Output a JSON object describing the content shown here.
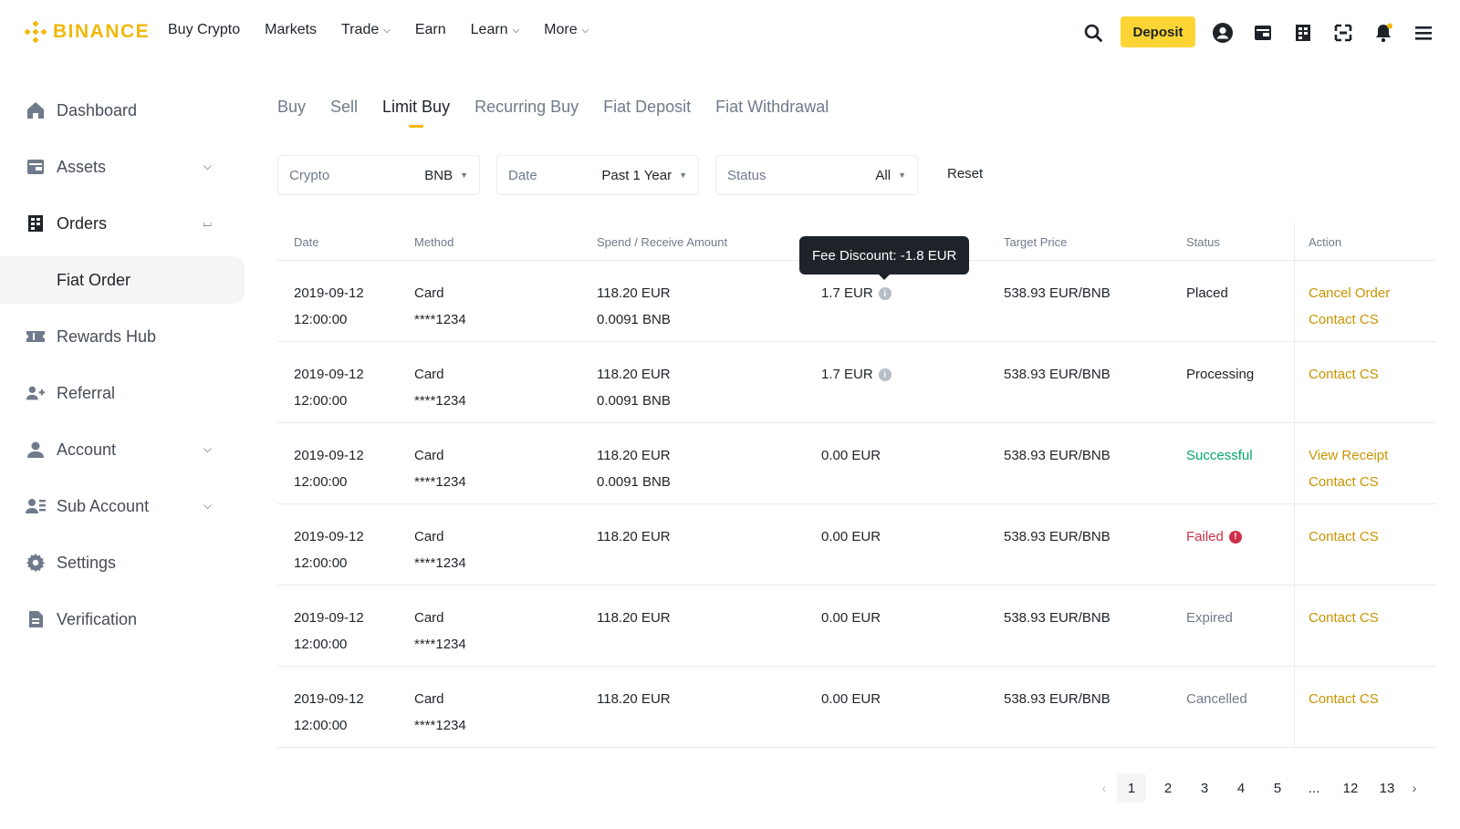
{
  "brand": {
    "name": "BINANCE",
    "color": "#f0b90b"
  },
  "nav": {
    "links": [
      {
        "label": "Buy Crypto",
        "has_dropdown": false
      },
      {
        "label": "Markets",
        "has_dropdown": false
      },
      {
        "label": "Trade",
        "has_dropdown": true
      },
      {
        "label": "Earn",
        "has_dropdown": false
      },
      {
        "label": "Learn",
        "has_dropdown": true
      },
      {
        "label": "More",
        "has_dropdown": true
      }
    ],
    "deposit_label": "Deposit",
    "icons": [
      "search-icon",
      "user-icon",
      "wallet-icon",
      "orders-icon",
      "download-icon",
      "bell-icon",
      "menu-icon"
    ]
  },
  "sidebar": {
    "items": [
      {
        "label": "Dashboard",
        "icon": "home-icon"
      },
      {
        "label": "Assets",
        "icon": "wallet-icon",
        "expanded": false
      },
      {
        "label": "Orders",
        "icon": "orders-icon",
        "expanded": true,
        "subitems": [
          {
            "label": "Fiat Order",
            "selected": true
          }
        ]
      },
      {
        "label": "Rewards Hub",
        "icon": "ticket-icon"
      },
      {
        "label": "Referral",
        "icon": "add-user-icon"
      },
      {
        "label": "Account",
        "icon": "person-icon",
        "expanded": false
      },
      {
        "label": "Sub Account",
        "icon": "sub-account-icon",
        "expanded": false
      },
      {
        "label": "Settings",
        "icon": "gear-icon"
      },
      {
        "label": "Verification",
        "icon": "document-icon"
      }
    ]
  },
  "tabs": [
    {
      "label": "Buy",
      "active": false
    },
    {
      "label": "Sell",
      "active": false
    },
    {
      "label": "Limit Buy",
      "active": true
    },
    {
      "label": "Recurring Buy",
      "active": false
    },
    {
      "label": "Fiat Deposit",
      "active": false
    },
    {
      "label": "Fiat Withdrawal",
      "active": false
    }
  ],
  "filters": {
    "crypto": {
      "label": "Crypto",
      "value": "BNB"
    },
    "date": {
      "label": "Date",
      "value": "Past 1 Year"
    },
    "status": {
      "label": "Status",
      "value": "All"
    },
    "reset_label": "Reset"
  },
  "table": {
    "headers": {
      "date": "Date",
      "method": "Method",
      "amount": "Spend / Receive Amount",
      "target_price": "Target Price",
      "status": "Status",
      "action": "Action"
    },
    "rows": [
      {
        "date": "2019-09-12",
        "time": "12:00:00",
        "method": "Card",
        "card": "****1234",
        "spend": "118.20 EUR",
        "receive": "0.0091 BNB",
        "fee": "1.7 EUR",
        "fee_info": true,
        "price": "538.93 EUR/BNB",
        "status": "Placed",
        "status_type": "normal",
        "actions": [
          "Cancel Order",
          "Contact CS"
        ]
      },
      {
        "date": "2019-09-12",
        "time": "12:00:00",
        "method": "Card",
        "card": "****1234",
        "spend": "118.20 EUR",
        "receive": "0.0091 BNB",
        "fee": "1.7 EUR",
        "fee_info": true,
        "price": "538.93 EUR/BNB",
        "status": "Processing",
        "status_type": "normal",
        "actions": [
          "Contact CS"
        ]
      },
      {
        "date": "2019-09-12",
        "time": "12:00:00",
        "method": "Card",
        "card": "****1234",
        "spend": "118.20 EUR",
        "receive": "0.0091 BNB",
        "fee": "0.00 EUR",
        "fee_info": false,
        "price": "538.93 EUR/BNB",
        "status": "Successful",
        "status_type": "success",
        "actions": [
          "View Receipt",
          "Contact CS"
        ]
      },
      {
        "date": "2019-09-12",
        "time": "12:00:00",
        "method": "Card",
        "card": "****1234",
        "spend": "118.20 EUR",
        "receive": "",
        "fee": "0.00 EUR",
        "fee_info": false,
        "price": "538.93 EUR/BNB",
        "status": "Failed",
        "status_type": "failed",
        "actions": [
          "Contact CS"
        ]
      },
      {
        "date": "2019-09-12",
        "time": "12:00:00",
        "method": "Card",
        "card": "****1234",
        "spend": "118.20 EUR",
        "receive": "",
        "fee": "0.00 EUR",
        "fee_info": false,
        "price": "538.93 EUR/BNB",
        "status": "Expired",
        "status_type": "muted",
        "actions": [
          "Contact CS"
        ]
      },
      {
        "date": "2019-09-12",
        "time": "12:00:00",
        "method": "Card",
        "card": "****1234",
        "spend": "118.20 EUR",
        "receive": "",
        "fee": "0.00 EUR",
        "fee_info": false,
        "price": "538.93 EUR/BNB",
        "status": "Cancelled",
        "status_type": "muted",
        "actions": [
          "Contact CS"
        ]
      }
    ]
  },
  "tooltip": {
    "text": "Fee Discount: -1.8 EUR"
  },
  "pagination": {
    "pages": [
      "1",
      "2",
      "3",
      "4",
      "5",
      "...",
      "12",
      "13"
    ],
    "current": "1"
  },
  "colors": {
    "accent": "#fcd535",
    "link": "#c99400",
    "success": "#03a66d",
    "danger": "#cf304a"
  }
}
